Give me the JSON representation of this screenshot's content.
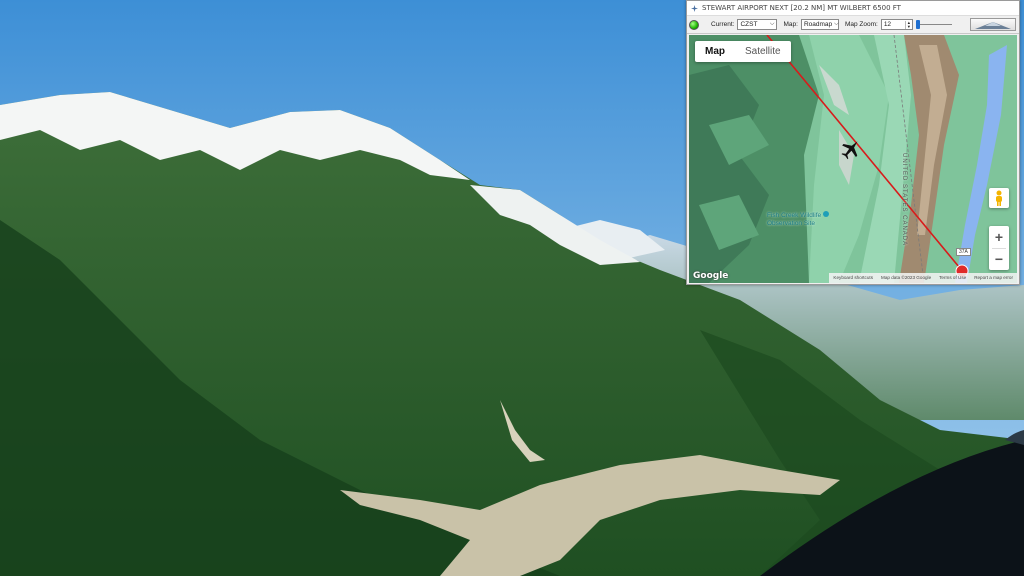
{
  "window": {
    "title": "STEWART AIRPORT NEXT [20.2 NM] MT WILBERT 6500 FT"
  },
  "toolbar": {
    "current_label": "Current:",
    "current_value": "CZST",
    "map_label": "Map:",
    "map_value": "Roadmap",
    "zoom_label": "Map Zoom:",
    "zoom_value": "12"
  },
  "map": {
    "tabs": [
      {
        "label": "Map",
        "active": true
      },
      {
        "label": "Satellite",
        "active": false
      }
    ],
    "poi_label_line1": "Fish Creek Wildlife",
    "poi_label_line2": "Observation Site",
    "border_label": "UNITED STATES CANADA",
    "road_shield": "37A",
    "google_logo": "Google",
    "attribution": {
      "keyboard": "Keyboard shortcuts",
      "data": "Map data ©2023 Google",
      "terms": "Terms of Use",
      "report": "Report a map error"
    },
    "zoom_in": "+",
    "zoom_out": "−",
    "route_color": "#d81b1b",
    "aircraft_icon": "airplane-icon"
  }
}
